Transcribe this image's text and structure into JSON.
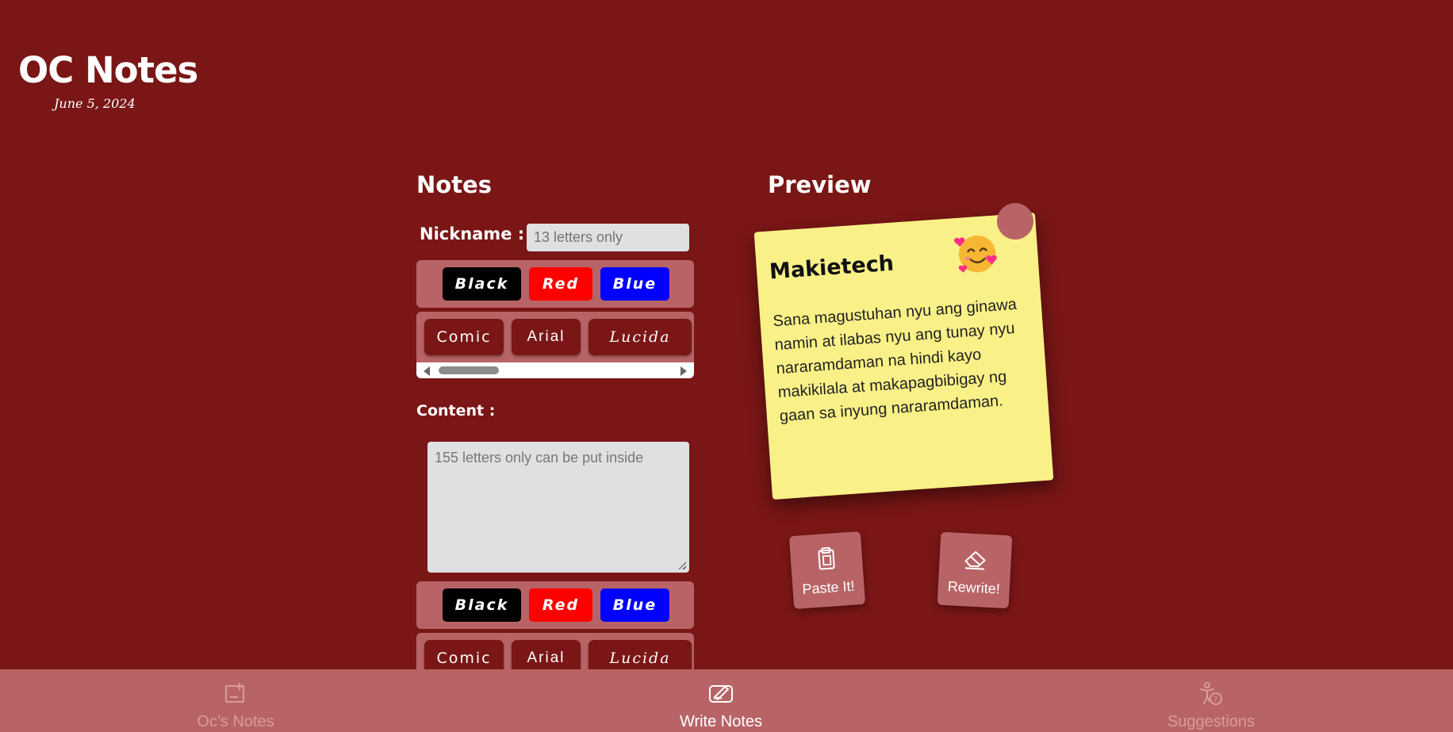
{
  "app": {
    "title": "OC Notes",
    "date": "June 5, 2024"
  },
  "form": {
    "heading": "Notes",
    "nickname_label": "Nickname :",
    "nickname_placeholder": "13 letters only",
    "nickname_value": "",
    "content_label": "Content :",
    "content_placeholder": "155 letters only can be put inside",
    "content_value": "",
    "color_options": [
      "Black",
      "Red",
      "Blue"
    ],
    "font_options": [
      "Comic",
      "Arial",
      "Lucida"
    ]
  },
  "preview": {
    "heading": "Preview",
    "nickname": "Makietech",
    "emoji": "smiling-face-with-hearts-icon",
    "content": "Sana magustuhan nyu ang ginawa namin at ilabas nyu ang tunay nyu nararamdaman na hindi kayo makikilala at makapagbibigay ng gaan sa inyung nararamdaman."
  },
  "actions": {
    "paste_label": "Paste It!",
    "rewrite_label": "Rewrite!"
  },
  "nav": {
    "items": [
      {
        "label": "Oc's Notes",
        "icon": "notes-icon",
        "active": false
      },
      {
        "label": "Write Notes",
        "icon": "write-icon",
        "active": true
      },
      {
        "label": "Suggestions",
        "icon": "suggestions-icon",
        "active": false
      }
    ]
  },
  "colors": {
    "background": "#7a1616",
    "panel": "#b86466",
    "note": "#f9f187",
    "black": "#000000",
    "red": "#ff0000",
    "blue": "#0000ff"
  }
}
